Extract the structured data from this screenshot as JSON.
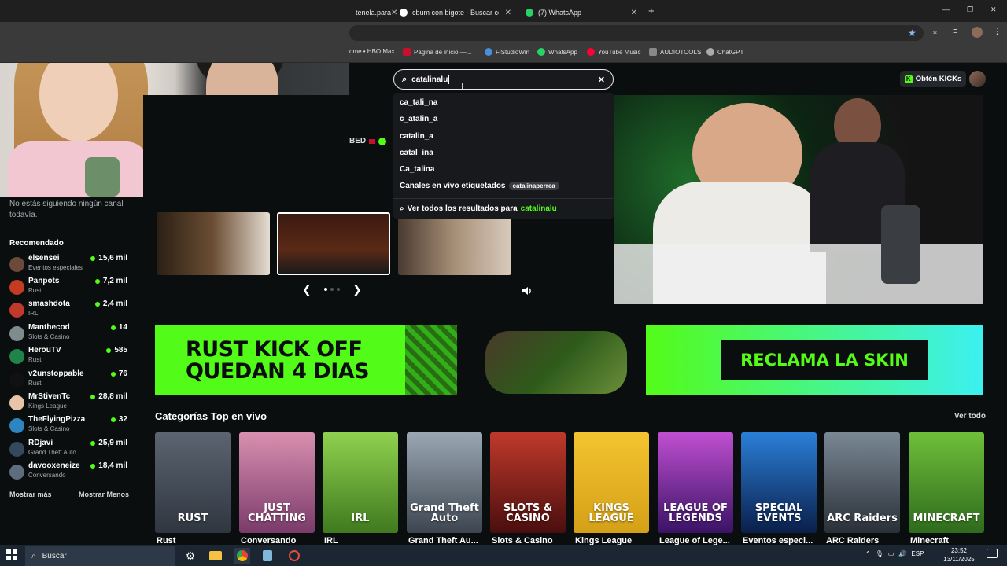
{
  "browser": {
    "tabs": [
      {
        "label": "tenela.para",
        "active": false
      },
      {
        "label": "cbum con bigote - Buscar con G",
        "active": false
      },
      {
        "label": "(7) WhatsApp",
        "active": true
      }
    ],
    "new_tab": "+",
    "window_controls": {
      "minimize": "—",
      "restore": "❐",
      "close": "✕"
    },
    "bookmarks": [
      {
        "label": "ome • HBO Max",
        "color": "#333"
      },
      {
        "label": "Página de inicio —...",
        "color": "#c8102e"
      },
      {
        "label": "FlStudioWin",
        "color": "#4a90d9"
      },
      {
        "label": "WhatsApp",
        "color": "#25d366"
      },
      {
        "label": "YouTube Music",
        "color": "#ff0033"
      },
      {
        "label": "AUDIOTOOLS",
        "color": "#888"
      },
      {
        "label": "ChatGPT",
        "color": "#aaa"
      }
    ]
  },
  "header": {
    "search_value": "catalinalu",
    "clear": "✕",
    "kicks_button": "Obtén KICKs"
  },
  "search_dropdown": {
    "suggestions": [
      "ca_tali_na",
      "c_atalin_a",
      "catalin_a",
      "catal_ina",
      "Ca_talina"
    ],
    "tagged_label": "Canales en vivo etiquetados",
    "tagged_pill": "catalinaperrea",
    "see_all_prefix": "Ver todos los resultados para",
    "see_all_query": "catalinalu"
  },
  "sidebar": {
    "no_follow": "No estás siguiendo ningún canal todavía.",
    "recommended_title": "Recomendado",
    "channels": [
      {
        "name": "elsensei",
        "category": "Eventos especiales",
        "viewers": "15,6 mil",
        "avatar": "#6b4a3a"
      },
      {
        "name": "Panpots",
        "category": "Rust",
        "viewers": "7,2 mil",
        "avatar": "#c23b22"
      },
      {
        "name": "smashdota",
        "category": "IRL",
        "viewers": "2,4 mil",
        "avatar": "#c0392b"
      },
      {
        "name": "Manthecod",
        "category": "Slots & Casino",
        "viewers": "14",
        "avatar": "#7f8c8d"
      },
      {
        "name": "HerouTV",
        "category": "Rust",
        "viewers": "585",
        "avatar": "#1e8449"
      },
      {
        "name": "v2unstoppable",
        "category": "Rust",
        "viewers": "76",
        "avatar": "#111111"
      },
      {
        "name": "MrStivenTc",
        "category": "Kings League",
        "viewers": "28,8 mil",
        "avatar": "#e8c4a8"
      },
      {
        "name": "TheFlyingPizza",
        "category": "Slots & Casino",
        "viewers": "32",
        "avatar": "#2e86c1"
      },
      {
        "name": "RDjavi",
        "category": "Grand Theft Auto ...",
        "viewers": "25,9 mil",
        "avatar": "#34495e"
      },
      {
        "name": "davooxeneize",
        "category": "Conversando",
        "viewers": "18,4 mil",
        "avatar": "#5d6d7e"
      }
    ],
    "show_more": "Mostrar más",
    "show_less": "Mostrar Menos"
  },
  "hero": {
    "partial_label": "BED",
    "prev": "❮",
    "next": "❯"
  },
  "banner": {
    "line1": "RUST KICK OFF",
    "line2": "QUEDAN 4 DIAS",
    "cta": "RECLAMA LA SKIN"
  },
  "categories": {
    "title": "Categorías Top en vivo",
    "see_all": "Ver todo",
    "items": [
      {
        "name": "Rust",
        "art": "RUST",
        "bg": "linear-gradient(#5b6470,#2f3640)"
      },
      {
        "name": "Conversando",
        "art": "JUST CHATTING",
        "bg": "linear-gradient(#d98fb0,#7a3b6a)"
      },
      {
        "name": "IRL",
        "art": "IRL",
        "bg": "linear-gradient(#8fd14f,#3f7a1e)"
      },
      {
        "name": "Grand Theft Au...",
        "art": "Grand Theft Auto",
        "bg": "linear-gradient(#9aa7b3,#3d4650)"
      },
      {
        "name": "Slots & Casino",
        "art": "SLOTS & CASINO",
        "bg": "linear-gradient(#c0392b,#4a0e0e)"
      },
      {
        "name": "Kings League",
        "art": "KINGS LEAGUE",
        "bg": "linear-gradient(#f4c430,#d4a017)"
      },
      {
        "name": "League of Lege...",
        "art": "LEAGUE OF LEGENDS",
        "bg": "linear-gradient(#c04fd1,#3a1366)"
      },
      {
        "name": "Eventos especi...",
        "art": "SPECIAL EVENTS",
        "bg": "linear-gradient(#2b7fd8,#0a1f4a)"
      },
      {
        "name": "ARC Raiders",
        "art": "ARC Raiders",
        "bg": "linear-gradient(#7a8894,#2a3038)"
      },
      {
        "name": "Minecraft",
        "art": "MINECRAFT",
        "bg": "linear-gradient(#6fbf3a,#2e6b1d)"
      }
    ]
  },
  "taskbar": {
    "search_placeholder": "Buscar",
    "time": "23:52",
    "date": "13/11/2025",
    "lang": "ESP"
  }
}
